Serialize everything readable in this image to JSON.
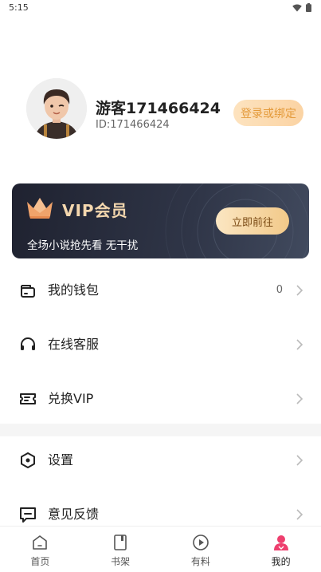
{
  "status_bar": {
    "time": "5:15"
  },
  "profile": {
    "username": "游客171466424",
    "user_id": "ID:171466424",
    "login_button": "登录或绑定"
  },
  "vip": {
    "title": "VIP会员",
    "subtitle": "全场小说抢先看 无干扰",
    "button": "立即前往"
  },
  "menu": {
    "wallet": {
      "label": "我的钱包",
      "count": "0",
      "icon": "wallet-icon"
    },
    "service": {
      "label": "在线客服",
      "icon": "headset-icon"
    },
    "redeem": {
      "label": "兑换VIP",
      "icon": "ticket-icon"
    },
    "settings": {
      "label": "设置",
      "icon": "hexagon-settings-icon"
    },
    "feedback": {
      "label": "意见反馈",
      "icon": "message-icon"
    }
  },
  "tabs": [
    {
      "label": "首页",
      "icon": "home-icon"
    },
    {
      "label": "书架",
      "icon": "bookshelf-icon"
    },
    {
      "label": "有料",
      "icon": "play-icon"
    },
    {
      "label": "我的",
      "icon": "user-icon",
      "active": true
    }
  ],
  "colors": {
    "accent_pink": "#ee3f6e",
    "vip_gold": "#f4d7ae",
    "login_orange": "#e49a3a"
  }
}
